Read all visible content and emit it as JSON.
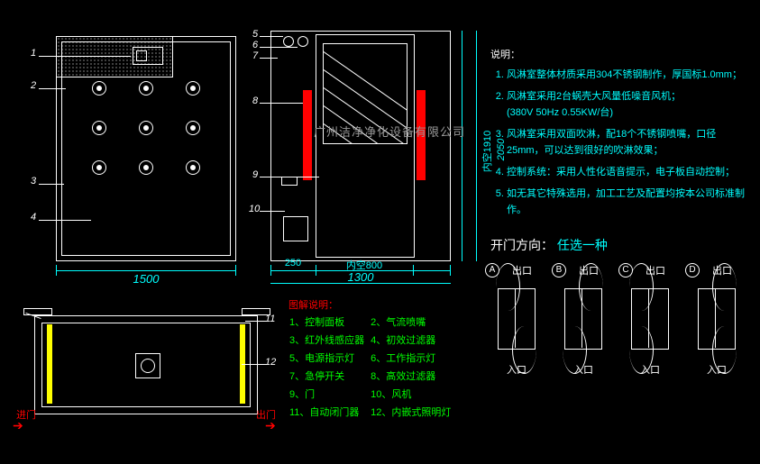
{
  "dimensions": {
    "front_width": "1500",
    "door_total_width": "1300",
    "door_clear_width": "内空800",
    "door_side": "250",
    "door_total_height": "2050",
    "door_clear_height": "内空1910"
  },
  "watermark": "广州洁净净化设备有限公司",
  "plan": {
    "in_label": "进门",
    "out_label": "出门"
  },
  "description": {
    "title": "说明：",
    "items": [
      "风淋室整体材质采用304不锈钢制作，厚国标1.0mm；",
      "风淋室采用2台蜗壳大风量低噪音风机；",
      "风淋室采用双面吹淋，配18个不锈钢喷嘴，口径25mm，可以达到很好的吹淋效果；",
      "控制系统：采用人性化语音提示，电子板自动控制；",
      "如无其它特殊选用，加工工艺及配置均按本公司标准制作。"
    ],
    "sub": "(380V  50Hz  0.55KW/台)"
  },
  "direction": {
    "title": "开门方向：",
    "choice": "任选一种",
    "tags": [
      "A",
      "B",
      "C",
      "D"
    ],
    "out": "出口",
    "in": "入口"
  },
  "legend": {
    "title": "图解说明：",
    "rows": [
      [
        "1、控制面板",
        "2、气流喷嘴"
      ],
      [
        "3、红外线感应器",
        "4、初效过滤器"
      ],
      [
        "5、电源指示灯",
        "6、工作指示灯"
      ],
      [
        "7、急停开关",
        "8、高效过滤器"
      ],
      [
        "9、门",
        "10、风机"
      ],
      [
        "11、自动闭门器",
        "12、内嵌式照明灯"
      ]
    ]
  },
  "leaders": {
    "front": [
      "1",
      "2",
      "3",
      "4"
    ],
    "door": [
      "5",
      "6",
      "7",
      "8",
      "9",
      "10"
    ],
    "plan": [
      "11",
      "12"
    ]
  }
}
